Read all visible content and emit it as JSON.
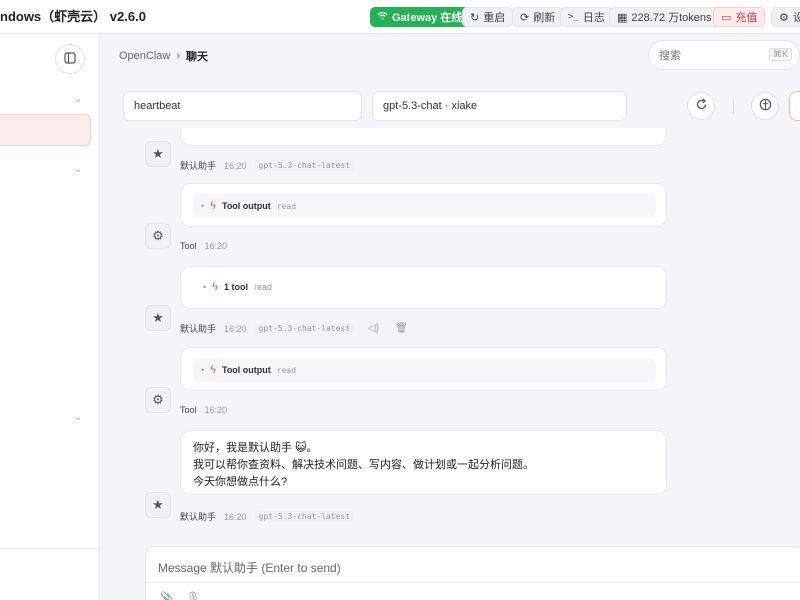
{
  "topbar": {
    "app_title": "ndows（虾壳云） v2.6.0",
    "gateway": "Gateway 在线",
    "restart": "重启",
    "refresh": "刷新",
    "logs": "日志",
    "tokens": "228.72 万tokens",
    "recharge": "充值",
    "settings": "设"
  },
  "breadcrumb": {
    "root": "OpenClaw",
    "separator": "›",
    "current": "聊天"
  },
  "search": {
    "placeholder": "搜索",
    "shortcut": "⌘K"
  },
  "controls": {
    "session": "heartbeat",
    "model": "gpt-5.3-chat · xiake"
  },
  "messages": [
    {
      "sender": "默认助手",
      "time": "16:20",
      "model": "gpt-5.3-chat-latest"
    },
    {
      "tool_label": "Tool output",
      "tool_arg": "read"
    },
    {
      "sender": "Tool",
      "time": "16:20"
    },
    {
      "tool_label": "1 tool",
      "tool_arg": "read"
    },
    {
      "sender": "默认助手",
      "time": "16:20",
      "model": "gpt-5.3-chat-latest"
    },
    {
      "tool_label": "Tool output",
      "tool_arg": "read"
    },
    {
      "sender": "Tool",
      "time": "16:20"
    },
    {
      "greeting_lines": [
        "你好，我是默认助手 😺。",
        "我可以帮你查资料、解决技术问题、写内容、做计划或一起分析问题。",
        "今天你想做点什么?"
      ]
    },
    {
      "sender": "默认助手",
      "time": "16:20",
      "model": "gpt-5.3-chat-latest"
    }
  ],
  "composer": {
    "placeholder": "Message 默认助手 (Enter to send)"
  },
  "colors": {
    "accent_red": "#d43b3b",
    "gateway_green": "#22b454",
    "background": "#f4f5f7"
  }
}
